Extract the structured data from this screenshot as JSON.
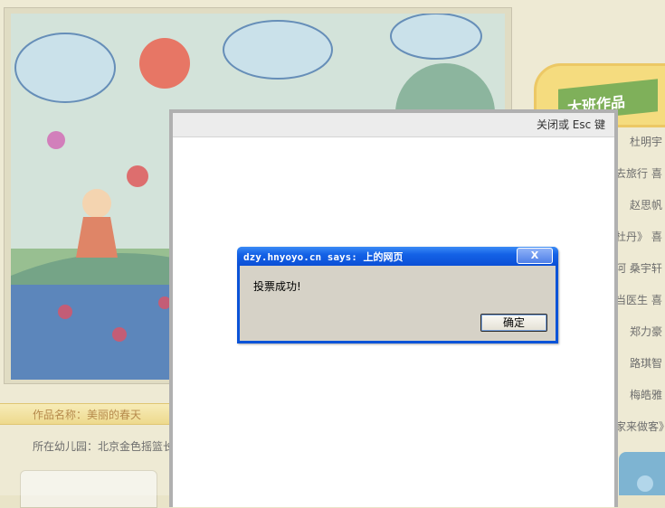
{
  "background_page": {
    "artwork_title_label": "作品名称：",
    "artwork_title": "美丽的春天",
    "kindergarten_label": "所在幼儿园：",
    "kindergarten_name": "北京金色摇篮长",
    "sidebar_badge": "大班作品",
    "sidebar_names": [
      "杜明宇",
      "去旅行 喜",
      "赵思帆",
      "杜丹》 喜",
      "河 桑宇轩",
      "当医生 喜",
      "郑力豪",
      "路琪智",
      "梅皓雅",
      "家来做客》"
    ]
  },
  "lightbox": {
    "close_hint": "关闭或 Esc 键"
  },
  "alert": {
    "title": "dzy.hnyoyo.cn says: 上的网页",
    "close_label": "X",
    "message": "投票成功!",
    "ok_label": "确定"
  }
}
